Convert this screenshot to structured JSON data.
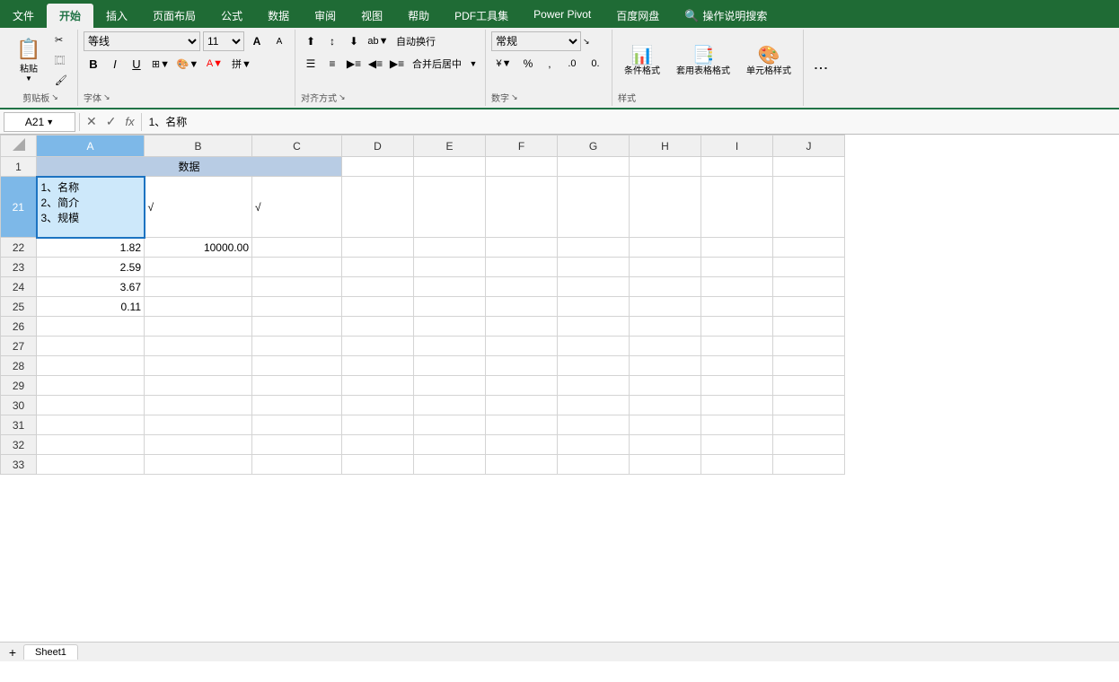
{
  "tabs": [
    {
      "label": "文件",
      "active": false
    },
    {
      "label": "开始",
      "active": true
    },
    {
      "label": "插入",
      "active": false
    },
    {
      "label": "页面布局",
      "active": false
    },
    {
      "label": "公式",
      "active": false
    },
    {
      "label": "数据",
      "active": false
    },
    {
      "label": "审阅",
      "active": false
    },
    {
      "label": "视图",
      "active": false
    },
    {
      "label": "帮助",
      "active": false
    },
    {
      "label": "PDF工具集",
      "active": false
    },
    {
      "label": "Power Pivot",
      "active": false
    },
    {
      "label": "百度网盘",
      "active": false
    },
    {
      "label": "操作说明搜索",
      "active": false
    }
  ],
  "ribbon": {
    "clipboard": {
      "label": "剪贴板",
      "paste_label": "粘贴",
      "cut_label": "剪切",
      "copy_label": "复制",
      "format_label": "格式刷"
    },
    "font": {
      "label": "字体",
      "font_name": "等线",
      "font_size": "11",
      "bold": "B",
      "italic": "I",
      "underline": "U",
      "border_label": "边框",
      "fill_label": "填充色",
      "font_color_label": "字体颜色",
      "special_label": "拼",
      "size_up": "A",
      "size_down": "A"
    },
    "alignment": {
      "label": "对齐方式",
      "wrap_text": "自动换行",
      "merge_center": "合并后居中"
    },
    "number": {
      "label": "数字",
      "format": "常规"
    },
    "styles": {
      "label": "样式",
      "conditional": "条件格式",
      "table_format": "套用表格格式",
      "cell_style": "单元格样式"
    }
  },
  "formula_bar": {
    "cell_ref": "A21",
    "formula": "1、名称"
  },
  "columns": [
    "A",
    "B",
    "C",
    "D",
    "E",
    "F",
    "G",
    "H",
    "I",
    "J"
  ],
  "rows": [
    {
      "row_num": "1",
      "cells": {
        "A": {
          "value": "数据",
          "merged": true,
          "align": "center",
          "colspan": 3
        },
        "B": {
          "value": "",
          "hidden": true
        },
        "C": {
          "value": "",
          "hidden": true
        },
        "D": {
          "value": ""
        },
        "E": {
          "value": ""
        },
        "F": {
          "value": ""
        },
        "G": {
          "value": ""
        },
        "H": {
          "value": ""
        },
        "I": {
          "value": ""
        },
        "J": {
          "value": ""
        }
      }
    },
    {
      "row_num": "21",
      "cells": {
        "A": {
          "value": "1、名称\n2、简介\n3、规模",
          "multiline": true,
          "selected": true
        },
        "B": {
          "value": "√"
        },
        "C": {
          "value": "√"
        },
        "D": {
          "value": ""
        },
        "E": {
          "value": ""
        },
        "F": {
          "value": ""
        },
        "G": {
          "value": ""
        },
        "H": {
          "value": ""
        },
        "I": {
          "value": ""
        },
        "J": {
          "value": ""
        }
      }
    },
    {
      "row_num": "22",
      "cells": {
        "A": {
          "value": "1.82",
          "align": "right"
        },
        "B": {
          "value": "10000.00",
          "align": "right"
        },
        "C": {
          "value": ""
        },
        "D": {
          "value": ""
        },
        "E": {
          "value": ""
        },
        "F": {
          "value": ""
        },
        "G": {
          "value": ""
        },
        "H": {
          "value": ""
        },
        "I": {
          "value": ""
        },
        "J": {
          "value": ""
        }
      }
    },
    {
      "row_num": "23",
      "cells": {
        "A": {
          "value": "2.59",
          "align": "right"
        },
        "B": {
          "value": ""
        },
        "C": {
          "value": ""
        },
        "D": {
          "value": ""
        },
        "E": {
          "value": ""
        },
        "F": {
          "value": ""
        },
        "G": {
          "value": ""
        },
        "H": {
          "value": ""
        },
        "I": {
          "value": ""
        },
        "J": {
          "value": ""
        }
      }
    },
    {
      "row_num": "24",
      "cells": {
        "A": {
          "value": "3.67",
          "align": "right"
        },
        "B": {
          "value": ""
        },
        "C": {
          "value": ""
        },
        "D": {
          "value": ""
        },
        "E": {
          "value": ""
        },
        "F": {
          "value": ""
        },
        "G": {
          "value": ""
        },
        "H": {
          "value": ""
        },
        "I": {
          "value": ""
        },
        "J": {
          "value": ""
        }
      }
    },
    {
      "row_num": "25",
      "cells": {
        "A": {
          "value": "0.11",
          "align": "right"
        },
        "B": {
          "value": ""
        },
        "C": {
          "value": ""
        },
        "D": {
          "value": ""
        },
        "E": {
          "value": ""
        },
        "F": {
          "value": ""
        },
        "G": {
          "value": ""
        },
        "H": {
          "value": ""
        },
        "I": {
          "value": ""
        },
        "J": {
          "value": ""
        }
      }
    },
    {
      "row_num": "26",
      "empty": true
    },
    {
      "row_num": "27",
      "empty": true
    },
    {
      "row_num": "28",
      "empty": true
    },
    {
      "row_num": "29",
      "empty": true
    },
    {
      "row_num": "30",
      "empty": true
    },
    {
      "row_num": "31",
      "empty": true
    },
    {
      "row_num": "32",
      "empty": true
    },
    {
      "row_num": "33",
      "empty": true
    }
  ],
  "sheet_tabs": [
    {
      "label": "Sheet1",
      "active": true
    }
  ],
  "colors": {
    "ribbon_bg": "#217346",
    "active_tab_bg": "#f0f0f0",
    "merged_cell_bg": "#b8cce4",
    "selected_cell_bg": "#cde8fa"
  }
}
